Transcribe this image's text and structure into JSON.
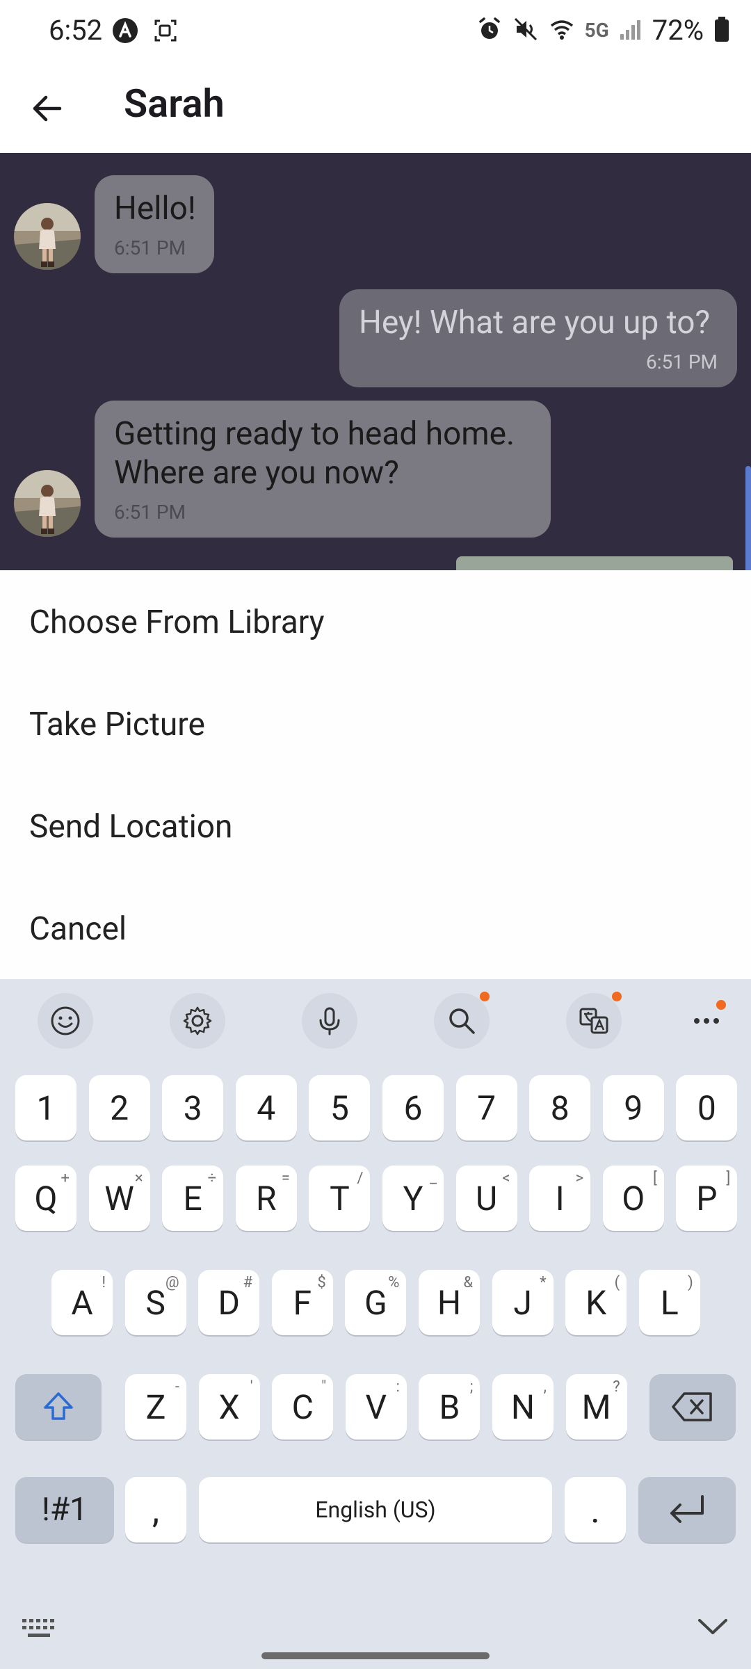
{
  "status_bar": {
    "time": "6:52",
    "network": "5G",
    "battery": "72%"
  },
  "header": {
    "title": "Sarah"
  },
  "messages": [
    {
      "direction": "in",
      "text": "Hello!",
      "time": "6:51 PM"
    },
    {
      "direction": "out",
      "text": "Hey! What are you up to?",
      "time": "6:51 PM"
    },
    {
      "direction": "in",
      "text": "Getting ready to head home.\nWhere are you now?",
      "time": "6:51 PM"
    }
  ],
  "action_sheet": {
    "items": [
      "Choose From Library",
      "Take Picture",
      "Send Location",
      "Cancel"
    ]
  },
  "keyboard": {
    "toolbar_icons": [
      "emoji-icon",
      "settings-icon",
      "microphone-icon",
      "search-icon",
      "translate-icon",
      "more-icon"
    ],
    "number_row": [
      "1",
      "2",
      "3",
      "4",
      "5",
      "6",
      "7",
      "8",
      "9",
      "0"
    ],
    "row1": [
      {
        "k": "Q",
        "s": "+"
      },
      {
        "k": "W",
        "s": "×"
      },
      {
        "k": "E",
        "s": "÷"
      },
      {
        "k": "R",
        "s": "="
      },
      {
        "k": "T",
        "s": "/"
      },
      {
        "k": "Y",
        "s": "_"
      },
      {
        "k": "U",
        "s": "<"
      },
      {
        "k": "I",
        "s": ">"
      },
      {
        "k": "O",
        "s": "["
      },
      {
        "k": "P",
        "s": "]"
      }
    ],
    "row2": [
      {
        "k": "A",
        "s": "!"
      },
      {
        "k": "S",
        "s": "@"
      },
      {
        "k": "D",
        "s": "#"
      },
      {
        "k": "F",
        "s": "$"
      },
      {
        "k": "G",
        "s": "%"
      },
      {
        "k": "H",
        "s": "&"
      },
      {
        "k": "J",
        "s": "*"
      },
      {
        "k": "K",
        "s": "("
      },
      {
        "k": "L",
        "s": ")"
      }
    ],
    "row3": [
      {
        "k": "Z",
        "s": "-"
      },
      {
        "k": "X",
        "s": "'"
      },
      {
        "k": "C",
        "s": "\""
      },
      {
        "k": "V",
        "s": ":"
      },
      {
        "k": "B",
        "s": ";"
      },
      {
        "k": "N",
        "s": ","
      },
      {
        "k": "M",
        "s": "?"
      }
    ],
    "symbols_label": "!#1",
    "comma": ",",
    "space_label": "English (US)",
    "period": "."
  },
  "colors": {
    "chat_background": "#312c3f",
    "bubble_in": "#7b7a83",
    "bubble_out": "#6c6a74",
    "keyboard_background": "#dfe3ec",
    "notification_dot": "#f06a1f"
  }
}
